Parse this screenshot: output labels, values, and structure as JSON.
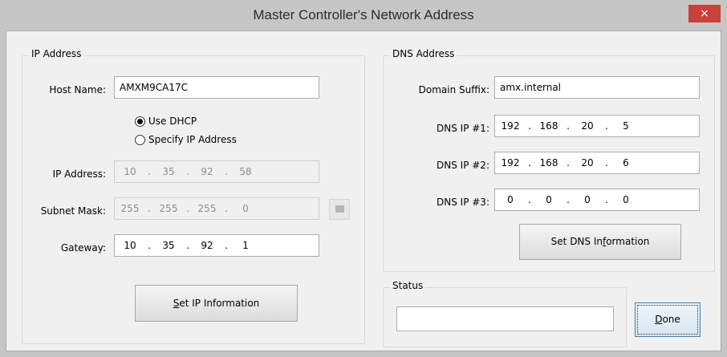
{
  "window": {
    "title": "Master Controller's Network Address",
    "close_glyph": "×"
  },
  "ip_group": {
    "title": "IP Address",
    "host_name_label": "Host Name:",
    "host_name_value": "AMXM9CA17C",
    "radio_dhcp": "Use DHCP",
    "radio_specify": "Specify IP Address",
    "dhcp_selected": true,
    "ip_label": "IP Address:",
    "ip": [
      "10",
      "35",
      "92",
      "58"
    ],
    "subnet_label": "Subnet Mask:",
    "subnet": [
      "255",
      "255",
      "255",
      "0"
    ],
    "gateway_label": "Gateway:",
    "gateway": [
      "10",
      "35",
      "92",
      "1"
    ],
    "set_button_prefix": "S",
    "set_button_rest": "et IP Information",
    "subnet_icon": "square-icon"
  },
  "dns_group": {
    "title": "DNS Address",
    "domain_label": "Domain Suffix:",
    "domain_value": "amx.internal",
    "dns1_label": "DNS IP #1:",
    "dns1": [
      "192",
      "168",
      "20",
      "5"
    ],
    "dns2_label": "DNS IP #2:",
    "dns2": [
      "192",
      "168",
      "20",
      "6"
    ],
    "dns3_label": "DNS IP #3:",
    "dns3": [
      "0",
      "0",
      "0",
      "0"
    ],
    "set_button_a": "Set DNS In",
    "set_button_u": "f",
    "set_button_b": "ormation"
  },
  "status_group": {
    "title": "Status",
    "value": ""
  },
  "done_button": {
    "u": "D",
    "rest": "one"
  }
}
